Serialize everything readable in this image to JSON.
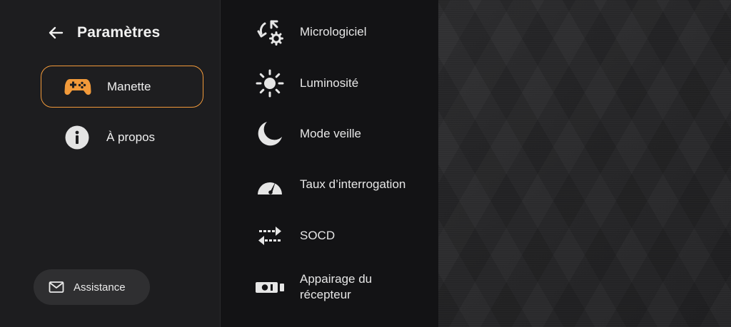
{
  "header": {
    "title": "Paramètres",
    "back_icon": "arrow-left-icon"
  },
  "sidebar": {
    "items": [
      {
        "label": "Manette",
        "icon": "gamepad-icon",
        "active": true
      },
      {
        "label": "À propos",
        "icon": "info-icon",
        "active": false
      }
    ],
    "support": {
      "label": "Assistance",
      "icon": "mail-icon"
    }
  },
  "menu": {
    "items": [
      {
        "label": "Micrologiciel",
        "icon": "firmware-update-icon"
      },
      {
        "label": "Luminosité",
        "icon": "sun-icon"
      },
      {
        "label": "Mode veille",
        "icon": "moon-icon"
      },
      {
        "label": "Taux d’interrogation",
        "icon": "gauge-icon"
      },
      {
        "label": "SOCD",
        "icon": "swap-arrows-icon"
      },
      {
        "label": "Appairage du récepteur",
        "icon": "receiver-icon"
      }
    ]
  },
  "colors": {
    "accent": "#f29a3a",
    "sidebar_bg": "#1d1d1f",
    "menu_bg": "#131315",
    "button_bg": "#2f2f31"
  }
}
